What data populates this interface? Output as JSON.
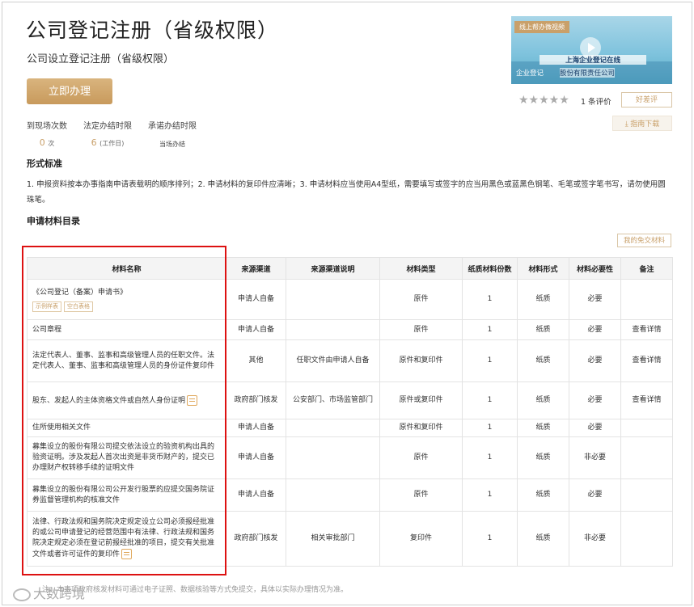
{
  "header": {
    "title": "公司登记注册（省级权限）",
    "subtitle": "公司设立登记注册（省级权限）",
    "apply_label": "立即办理"
  },
  "stats": [
    {
      "label": "到现场次数",
      "value": "0",
      "unit": "次"
    },
    {
      "label": "法定办结时限",
      "value": "6",
      "unit": "(工作日)"
    },
    {
      "label": "承诺办结时限",
      "value": "",
      "unit": "当场办结"
    }
  ],
  "video": {
    "badge": "线上帮办微视频",
    "line1": "上海企业登记在线",
    "line2": "企业登记",
    "line3": "股份有限责任公司"
  },
  "rating": {
    "stars_text": "★★★★★",
    "count": "1 条评价",
    "review_label": "好差评",
    "guide_label": "⤓ 指南下载"
  },
  "form_standard": {
    "heading": "形式标准",
    "text": "1. 申报资料按本办事指南申请表载明的顺序排列；2. 申请材料的复印件应清晰；3. 申请材料应当使用A4型纸，需要填写或签字的应当用黑色或蓝黑色钢笔、毛笔或签字笔书写，请勿使用圆珠笔。"
  },
  "materials": {
    "heading": "申请材料目录",
    "free_label": "我的免交材料",
    "columns": [
      "材料名称",
      "来源渠道",
      "来源渠道说明",
      "材料类型",
      "纸质材料份数",
      "材料形式",
      "材料必要性",
      "备注"
    ],
    "rows": [
      {
        "name": "《公司登记（备案）申请书》",
        "tags": [
          "示例样表",
          "空白表格"
        ],
        "source": "申请人自备",
        "source_desc": "",
        "type": "原件",
        "copies": "1",
        "form": "纸质",
        "necessity": "必要",
        "note": ""
      },
      {
        "name": "公司章程",
        "tags": [],
        "source": "申请人自备",
        "source_desc": "",
        "type": "原件",
        "copies": "1",
        "form": "纸质",
        "necessity": "必要",
        "note": "查看详情"
      },
      {
        "name": "法定代表人、董事、监事和高级管理人员的任职文件。法定代表人、董事、监事和高级管理人员的身份证件复印件",
        "tags": [],
        "source": "其他",
        "source_desc": "任职文件由申请人自备",
        "type": "原件和复印件",
        "copies": "1",
        "form": "纸质",
        "necessity": "必要",
        "note": "查看详情"
      },
      {
        "name": "股东、发起人的主体资格文件或自然人身份证明",
        "tags": [],
        "icon": true,
        "source": "政府部门核发",
        "source_desc": "公安部门、市场监管部门",
        "type": "原件或复印件",
        "copies": "1",
        "form": "纸质",
        "necessity": "必要",
        "note": "查看详情"
      },
      {
        "name": "住所使用相关文件",
        "tags": [],
        "source": "申请人自备",
        "source_desc": "",
        "type": "原件和复印件",
        "copies": "1",
        "form": "纸质",
        "necessity": "必要",
        "note": ""
      },
      {
        "name": "募集设立的股份有限公司提交依法设立的验资机构出具的验资证明。涉及发起人首次出资是非货币财产的，提交已办理财产权转移手续的证明文件",
        "tags": [],
        "source": "申请人自备",
        "source_desc": "",
        "type": "原件",
        "copies": "1",
        "form": "纸质",
        "necessity": "非必要",
        "note": ""
      },
      {
        "name": "募集设立的股份有限公司公开发行股票的应提交国务院证券监督管理机构的核准文件",
        "tags": [],
        "source": "申请人自备",
        "source_desc": "",
        "type": "原件",
        "copies": "1",
        "form": "纸质",
        "necessity": "必要",
        "note": ""
      },
      {
        "name": "法律、行政法规和国务院决定规定设立公司必须报经批准的或公司申请登记的经营范围中有法律、行政法规和国务院决定规定必须在登记前报经批准的项目，提交有关批准文件或者许可证件的复印件",
        "tags": [],
        "icon": true,
        "source": "政府部门核发",
        "source_desc": "相关审批部门",
        "type": "复印件",
        "copies": "1",
        "form": "纸质",
        "necessity": "非必要",
        "note": ""
      }
    ],
    "footnote": "注：本事项政府核发材料可通过电子证照、数据核验等方式免提交，具体以实际办理情况为准。"
  },
  "watermark": "大数跨境"
}
